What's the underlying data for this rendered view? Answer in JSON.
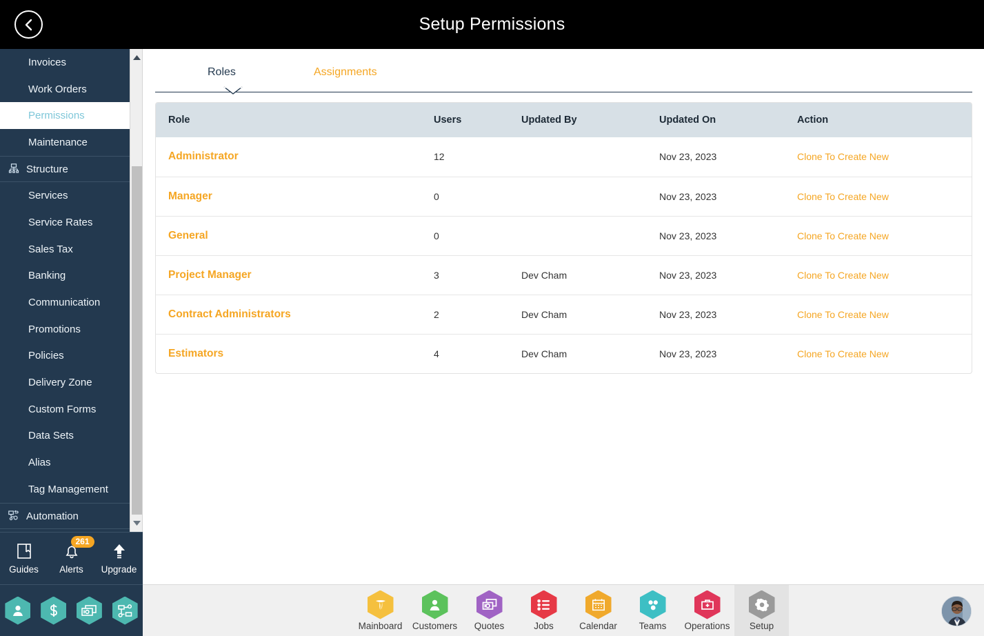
{
  "header": {
    "title": "Setup Permissions",
    "back_icon": "chevron-left-circle-icon"
  },
  "sidebar": {
    "items": [
      {
        "label": "Invoices",
        "type": "link",
        "state": "normal"
      },
      {
        "label": "Work Orders",
        "type": "link",
        "state": "normal"
      },
      {
        "label": "Permissions",
        "type": "link",
        "state": "active"
      },
      {
        "label": "Maintenance",
        "type": "link",
        "state": "normal"
      },
      {
        "label": "Structure",
        "type": "group",
        "state": "normal",
        "icon": "structure-icon"
      },
      {
        "label": "Services",
        "type": "link",
        "state": "normal"
      },
      {
        "label": "Service Rates",
        "type": "link",
        "state": "normal"
      },
      {
        "label": "Sales Tax",
        "type": "link",
        "state": "normal"
      },
      {
        "label": "Banking",
        "type": "link",
        "state": "normal"
      },
      {
        "label": "Communication",
        "type": "link",
        "state": "normal"
      },
      {
        "label": "Promotions",
        "type": "link",
        "state": "normal"
      },
      {
        "label": "Policies",
        "type": "link",
        "state": "normal"
      },
      {
        "label": "Delivery Zone",
        "type": "link",
        "state": "normal"
      },
      {
        "label": "Custom Forms",
        "type": "link",
        "state": "normal"
      },
      {
        "label": "Data Sets",
        "type": "link",
        "state": "normal"
      },
      {
        "label": "Alias",
        "type": "link",
        "state": "normal"
      },
      {
        "label": "Tag Management",
        "type": "link",
        "state": "normal"
      },
      {
        "label": "Automation",
        "type": "group",
        "state": "normal",
        "icon": "automation-icon"
      }
    ],
    "tools": [
      {
        "label": "Guides",
        "icon": "book-icon",
        "badge": null
      },
      {
        "label": "Alerts",
        "icon": "bell-icon",
        "badge": "261"
      },
      {
        "label": "Upgrade",
        "icon": "arrow-up-icon",
        "badge": null
      }
    ],
    "quick_icons": [
      {
        "name": "user-hex-icon"
      },
      {
        "name": "dollar-hex-icon"
      },
      {
        "name": "payment-hex-icon"
      },
      {
        "name": "workflow-hex-icon"
      }
    ],
    "quick_icon_color": "#4db8b0"
  },
  "tabs": [
    {
      "label": "Roles",
      "state": "active"
    },
    {
      "label": "Assignments",
      "state": "inactive"
    }
  ],
  "table": {
    "columns": [
      "Role",
      "Users",
      "Updated By",
      "Updated On",
      "Action"
    ],
    "rows": [
      {
        "role": "Administrator",
        "users": "12",
        "updated_by": "",
        "updated_on": "Nov 23, 2023",
        "action": "Clone To Create New"
      },
      {
        "role": "Manager",
        "users": "0",
        "updated_by": "",
        "updated_on": "Nov 23, 2023",
        "action": "Clone To Create New"
      },
      {
        "role": "General",
        "users": "0",
        "updated_by": "",
        "updated_on": "Nov 23, 2023",
        "action": "Clone To Create New"
      },
      {
        "role": "Project Manager",
        "users": "3",
        "updated_by": "Dev Cham",
        "updated_on": "Nov 23, 2023",
        "action": "Clone To Create New"
      },
      {
        "role": "Contract Administrators",
        "users": "2",
        "updated_by": "Dev Cham",
        "updated_on": "Nov 23, 2023",
        "action": "Clone To Create New"
      },
      {
        "role": "Estimators",
        "users": "4",
        "updated_by": "Dev Cham",
        "updated_on": "Nov 23, 2023",
        "action": "Clone To Create New"
      }
    ]
  },
  "bottom_nav": {
    "items": [
      {
        "label": "Mainboard",
        "icon": "mainboard-icon",
        "color": "#f5c03e",
        "selected": false
      },
      {
        "label": "Customers",
        "icon": "customers-icon",
        "color": "#5cc25c",
        "selected": false
      },
      {
        "label": "Quotes",
        "icon": "quotes-icon",
        "color": "#a063c4",
        "selected": false
      },
      {
        "label": "Jobs",
        "icon": "jobs-icon",
        "color": "#e63946",
        "selected": false
      },
      {
        "label": "Calendar",
        "icon": "calendar-icon",
        "color": "#f0a92c",
        "selected": false
      },
      {
        "label": "Teams",
        "icon": "teams-icon",
        "color": "#3dbfc4",
        "selected": false
      },
      {
        "label": "Operations",
        "icon": "operations-icon",
        "color": "#e0365a",
        "selected": false
      },
      {
        "label": "Setup",
        "icon": "setup-gear-icon",
        "color": "#9a9a9a",
        "selected": true
      }
    ],
    "avatar": "user-avatar"
  },
  "colors": {
    "accent_orange": "#f5a623",
    "sidebar_navy": "#23394f",
    "header_black": "#000000",
    "table_header": "#d7e0e6",
    "active_nav_text": "#7fc7d9"
  }
}
